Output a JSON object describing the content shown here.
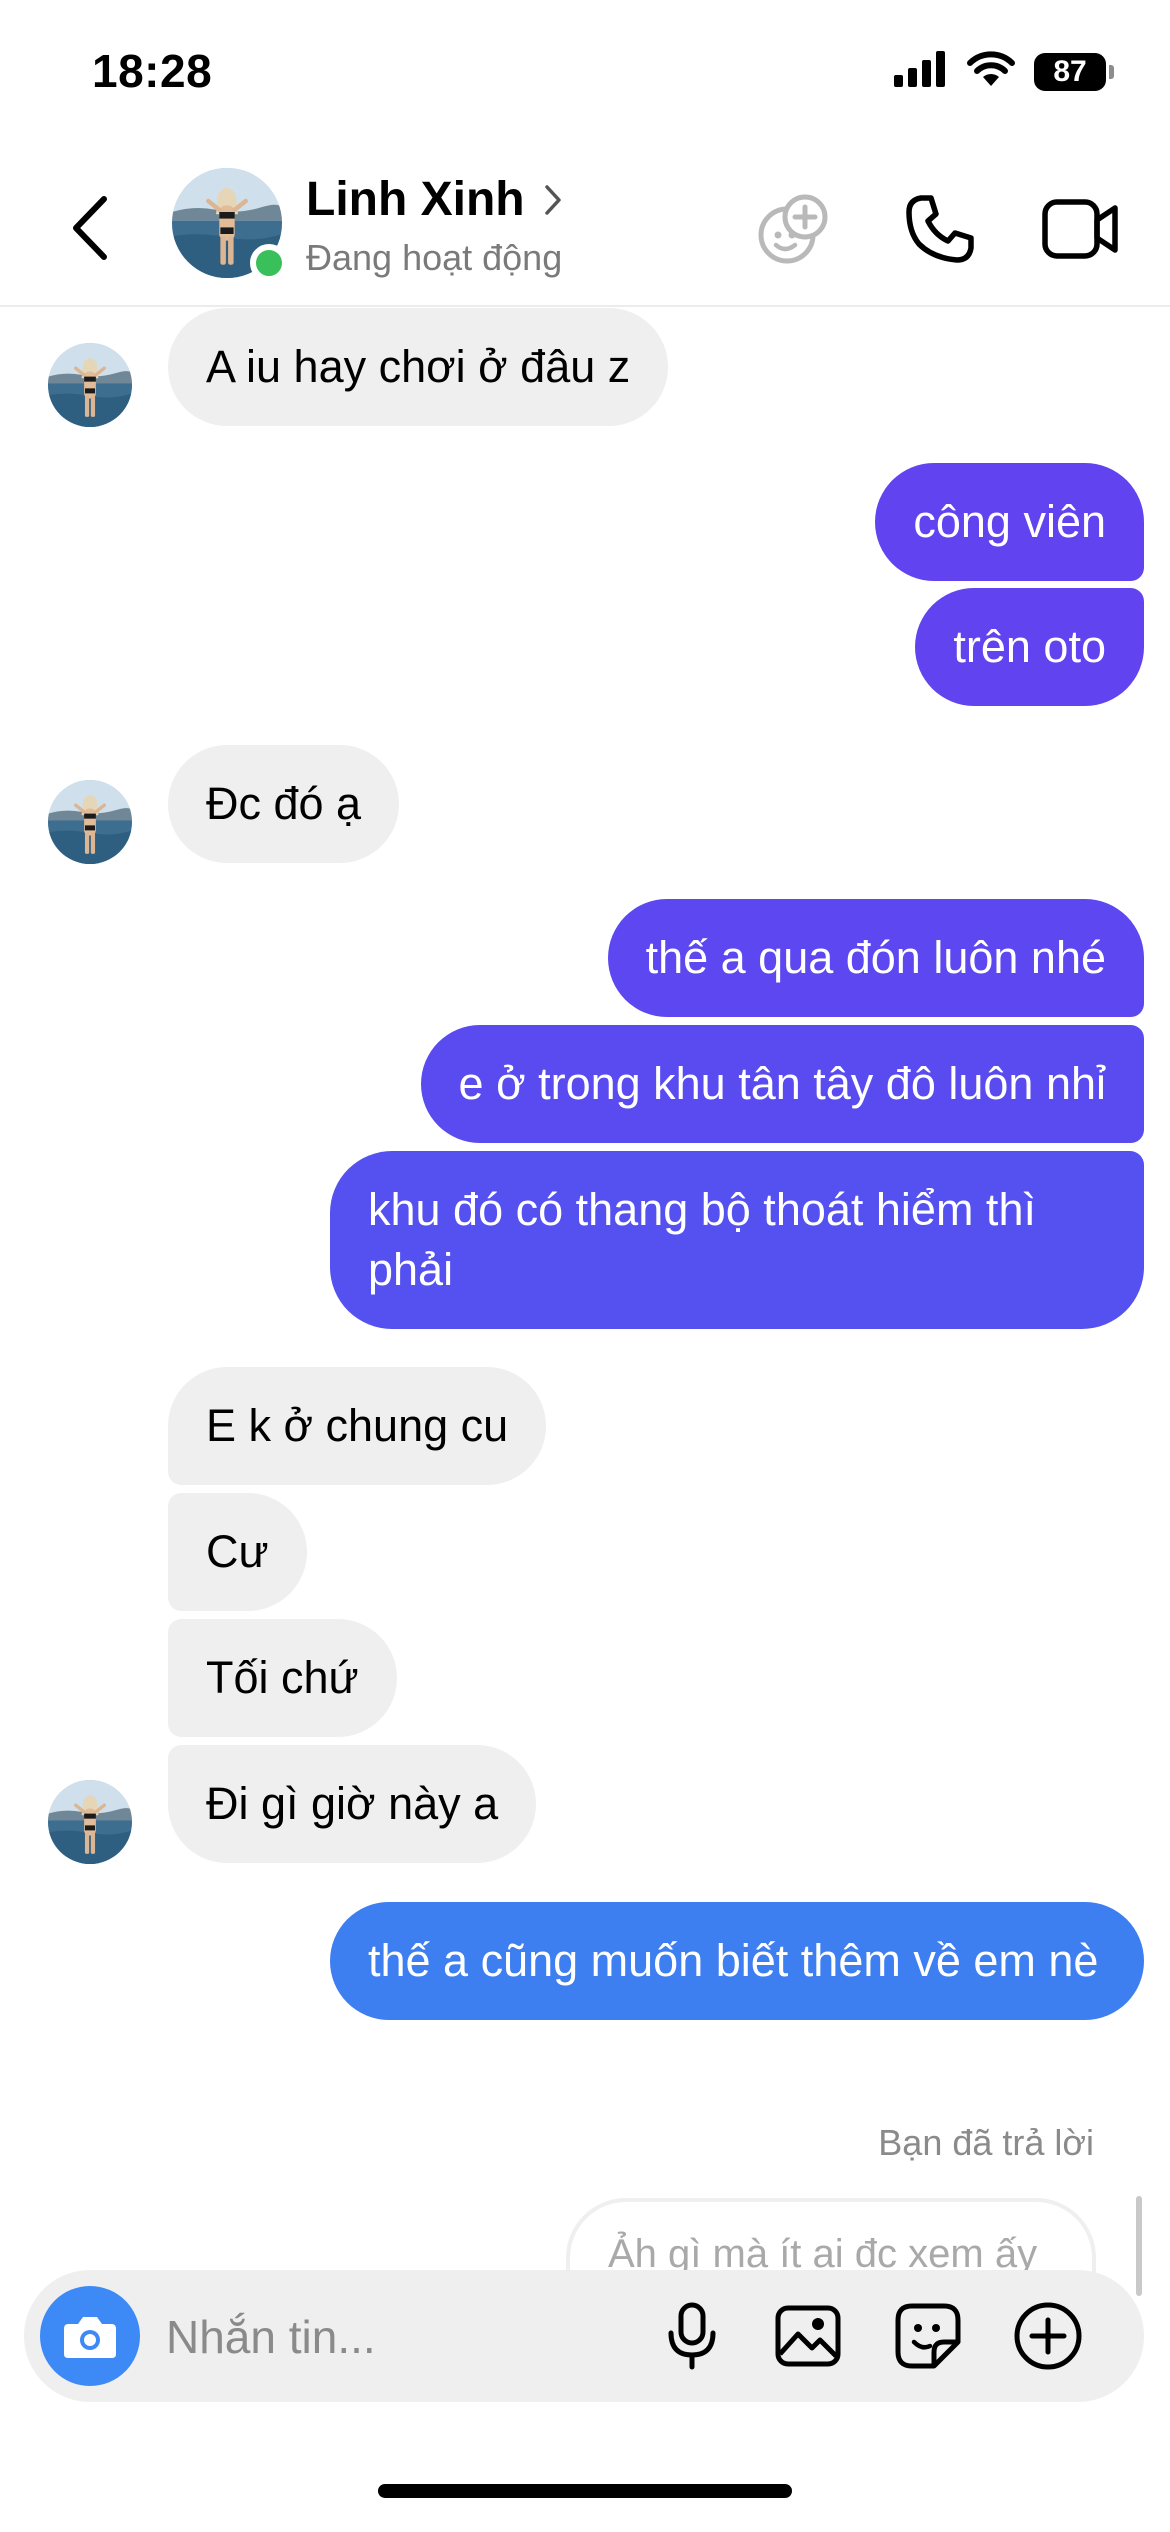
{
  "status_bar": {
    "time": "18:28",
    "battery": "87",
    "icons": [
      "cellular-signal-icon",
      "wifi-icon",
      "battery-icon"
    ]
  },
  "header": {
    "contact_name": "Linh Xinh",
    "status": "Đang hoạt động",
    "icons": [
      "back-chevron-icon",
      "avatar-image",
      "online-dot",
      "chevron-right-icon",
      "add-effect-icon",
      "phone-icon",
      "video-camera-icon"
    ]
  },
  "colors": {
    "incoming_bubble": "#efefef",
    "outgoing_purple": "#6143f0",
    "outgoing_indigo": "#5a4bf0",
    "outgoing_blue": "#3d7ef0",
    "online": "#3ac05a",
    "camera_button": "#3d8af7"
  },
  "messages": [
    {
      "direction": "in",
      "text": "A iu hay chơi ở đâu z"
    },
    {
      "direction": "out",
      "text": "công viên"
    },
    {
      "direction": "out",
      "text": "trên oto"
    },
    {
      "direction": "in",
      "text": "Đc đó ạ"
    },
    {
      "direction": "out",
      "text": "thế a qua đón luôn nhé"
    },
    {
      "direction": "out",
      "text": "e ở trong khu tân tây đô luôn nhỉ"
    },
    {
      "direction": "out",
      "text": "khu đó có thang bộ thoát hiểm thì phải"
    },
    {
      "direction": "in",
      "text": "E k ở chung cu"
    },
    {
      "direction": "in",
      "text": "Cư"
    },
    {
      "direction": "in",
      "text": "Tối chứ"
    },
    {
      "direction": "in",
      "text": "Đi gì giờ này a"
    },
    {
      "direction": "out",
      "text": "thế a cũng muốn biết thêm về em nè"
    }
  ],
  "reply": {
    "note": "Bạn đã trả lời",
    "preview": "Ảh gì mà ít ai đc xem ấy"
  },
  "composer": {
    "placeholder": "Nhắn tin...",
    "icons": [
      "camera-icon",
      "microphone-icon",
      "gallery-icon",
      "sticker-icon",
      "plus-circle-icon"
    ]
  }
}
